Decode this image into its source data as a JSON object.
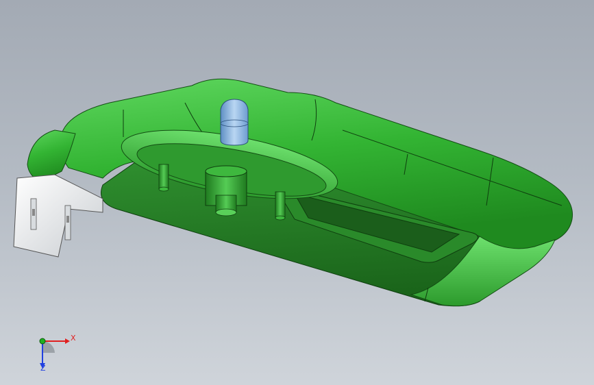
{
  "viewport": {
    "background_top": "#a3aab4",
    "background_bottom": "#cfd4da",
    "model": {
      "body_color": "#2fa52f",
      "body_dark_color": "#1f6f1f",
      "connector_color": "#e6e8ea",
      "fitting_color": "#8db8e0"
    },
    "triad": {
      "x_label": "X",
      "z_label": "Z",
      "x_color": "#e02020",
      "y_color": "#20b020",
      "z_color": "#2040e0"
    }
  }
}
